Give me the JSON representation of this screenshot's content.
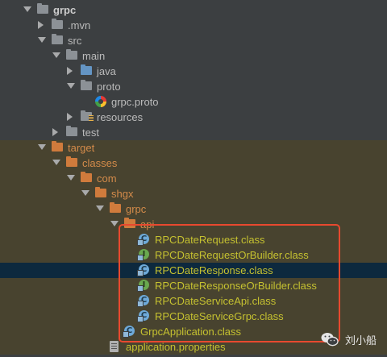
{
  "project_tree": {
    "rows": [
      {
        "label": "grpc",
        "arrow": "down",
        "icon": "folder-gray",
        "style": "bold",
        "indent": 0,
        "row_bg": "none"
      },
      {
        "label": ".mvn",
        "arrow": "right",
        "icon": "folder-gray",
        "style": "plain",
        "indent": 1,
        "row_bg": "none"
      },
      {
        "label": "src",
        "arrow": "down",
        "icon": "folder-gray",
        "style": "plain",
        "indent": 1,
        "row_bg": "none"
      },
      {
        "label": "main",
        "arrow": "down",
        "icon": "folder-gray",
        "style": "plain",
        "indent": 2,
        "row_bg": "none"
      },
      {
        "label": "java",
        "arrow": "right",
        "icon": "folder-blue",
        "style": "plain",
        "indent": 3,
        "row_bg": "none"
      },
      {
        "label": "proto",
        "arrow": "down",
        "icon": "folder-gray",
        "style": "plain",
        "indent": 3,
        "row_bg": "none"
      },
      {
        "label": "grpc.proto",
        "arrow": "none",
        "icon": "proto-file-icon",
        "style": "plain",
        "indent": 4,
        "row_bg": "none"
      },
      {
        "label": "resources",
        "arrow": "right",
        "icon": "folder-resources",
        "style": "plain",
        "indent": 3,
        "row_bg": "none"
      },
      {
        "label": "test",
        "arrow": "right",
        "icon": "folder-gray",
        "style": "plain",
        "indent": 2,
        "row_bg": "none"
      },
      {
        "label": "target",
        "arrow": "down",
        "icon": "folder-orange",
        "style": "orange",
        "indent": 1,
        "row_bg": "excluded"
      },
      {
        "label": "classes",
        "arrow": "down",
        "icon": "folder-orange",
        "style": "orange",
        "indent": 2,
        "row_bg": "excluded"
      },
      {
        "label": "com",
        "arrow": "down",
        "icon": "folder-orange",
        "style": "orange",
        "indent": 3,
        "row_bg": "excluded"
      },
      {
        "label": "shgx",
        "arrow": "down",
        "icon": "folder-orange",
        "style": "orange",
        "indent": 4,
        "row_bg": "excluded"
      },
      {
        "label": "grpc",
        "arrow": "down",
        "icon": "folder-orange",
        "style": "orange",
        "indent": 5,
        "row_bg": "excluded"
      },
      {
        "label": "api",
        "arrow": "down",
        "icon": "folder-orange",
        "style": "orange",
        "indent": 6,
        "row_bg": "excluded"
      },
      {
        "label": "RPCDateRequest.class",
        "arrow": "none",
        "icon": "class-c",
        "style": "yellow",
        "indent": 7,
        "row_bg": "excluded"
      },
      {
        "label": "RPCDateRequestOrBuilder.class",
        "arrow": "none",
        "icon": "class-i",
        "style": "yellow",
        "indent": 7,
        "row_bg": "excluded"
      },
      {
        "label": "RPCDateResponse.class",
        "arrow": "none",
        "icon": "class-c",
        "style": "yellow",
        "indent": 7,
        "row_bg": "selected"
      },
      {
        "label": "RPCDateResponseOrBuilder.class",
        "arrow": "none",
        "icon": "class-i",
        "style": "yellow",
        "indent": 7,
        "row_bg": "excluded"
      },
      {
        "label": "RPCDateServiceApi.class",
        "arrow": "none",
        "icon": "class-c",
        "style": "yellow",
        "indent": 7,
        "row_bg": "excluded"
      },
      {
        "label": "RPCDateServiceGrpc.class",
        "arrow": "none",
        "icon": "class-c",
        "style": "yellow",
        "indent": 7,
        "row_bg": "excluded"
      },
      {
        "label": "GrpcApplication.class",
        "arrow": "none",
        "icon": "class-c",
        "style": "yellow",
        "indent": 6,
        "row_bg": "excluded"
      },
      {
        "label": "application.properties",
        "arrow": "none",
        "icon": "properties-file-icon",
        "style": "yellow",
        "indent": 5,
        "row_bg": "excluded"
      }
    ]
  },
  "watermark": {
    "text": "刘小船",
    "icon": "wechat-icon"
  },
  "colors": {
    "highlight_box": "#e8492f",
    "selected_row": "#0d293e",
    "excluded_row": "#48432f"
  }
}
